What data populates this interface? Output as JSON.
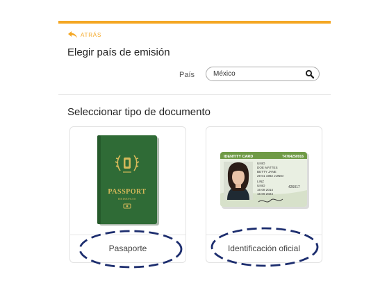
{
  "header": {
    "back_label": "ATRÁS",
    "accent_color": "#f4a724"
  },
  "country_section": {
    "title": "Elegir país de emisión",
    "field_label": "País",
    "field_value": "México",
    "search_icon": "search-icon"
  },
  "document_section": {
    "title": "Seleccionar tipo de documento",
    "options": [
      {
        "label": "Pasaporte",
        "image": "green-passport"
      },
      {
        "label": "Identificación oficial",
        "image": "id-card"
      }
    ]
  },
  "passport_cover": {
    "title": "PASSPORT",
    "subtitle": "REISEPASS"
  },
  "id_card": {
    "header": "IDENTITY CARD",
    "number": "T4764250916",
    "lines": [
      "UNIO",
      "DOE MATTES",
      "BETTY JANE",
      "29 01 1982 JUNIO",
      "LINZ",
      "UNIO",
      "16 08 2014",
      "16 09 2024"
    ],
    "side_number": "426017"
  },
  "annotation_color": "#1c2d6e"
}
